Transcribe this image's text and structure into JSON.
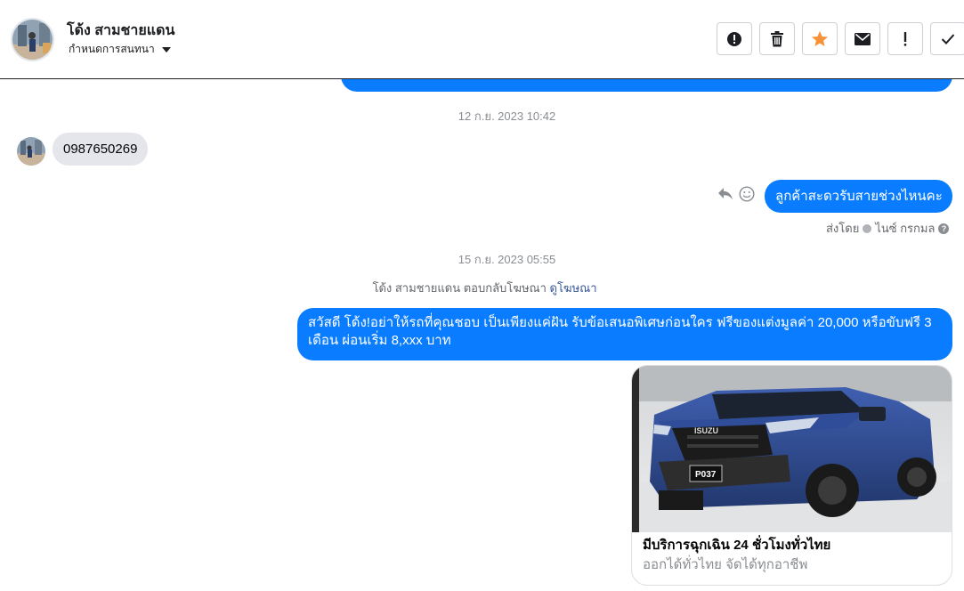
{
  "header": {
    "contact_name": "โด้ง สามชายแดน",
    "subtitle": "กำหนดการสนทนา",
    "toolbar": [
      {
        "name": "spam-alert-button",
        "icon": "exclamation-circle-icon"
      },
      {
        "name": "delete-button",
        "icon": "trash-icon"
      },
      {
        "name": "star-button",
        "icon": "star-icon"
      },
      {
        "name": "mark-unread-button",
        "icon": "envelope-icon"
      },
      {
        "name": "important-button",
        "icon": "exclamation-icon"
      },
      {
        "name": "done-button",
        "icon": "check-icon"
      }
    ]
  },
  "messages": {
    "ts1": "12 ก.ย. 2023 10:42",
    "incoming_phone": "0987650269",
    "outgoing_question": "ลูกค้าสะดวรับสายช่วงไหนคะ",
    "sent_by_label": "ส่งโดย",
    "sent_by_name": "ไนซ์ กรกมล",
    "ts2": "15 ก.ย. 2023 05:55",
    "ad_reply_text": "โด้ง สามชายแดน ตอบกลับโฆษณา",
    "ad_link": "ดูโฆษณา",
    "ad_message_line1": "สวัสดี โด้ง!อย่าให้รถที่คุณชอบ เป็นเพียงแค่ฝัน รับข้อเสนอพิเศษก่อนใคร ฟรีของแต่งมูลค่า 20,000 หรือขับฟรี 3",
    "ad_message_line2": "เดือน ผ่อนเริ่ม 8,xxx บาท",
    "card_title": "มีบริการฉุกเฉิน 24 ชั่วโมงทั่วไทย",
    "card_subtitle": "ออกได้ทั่วไทย จัดได้ทุกอาชีพ",
    "card_plate": "P037",
    "card_brand": "ISUZU"
  },
  "colors": {
    "outgoing_bubble": "#0a7cff",
    "incoming_bubble": "#e4e6eb",
    "star": "#f7923a"
  }
}
